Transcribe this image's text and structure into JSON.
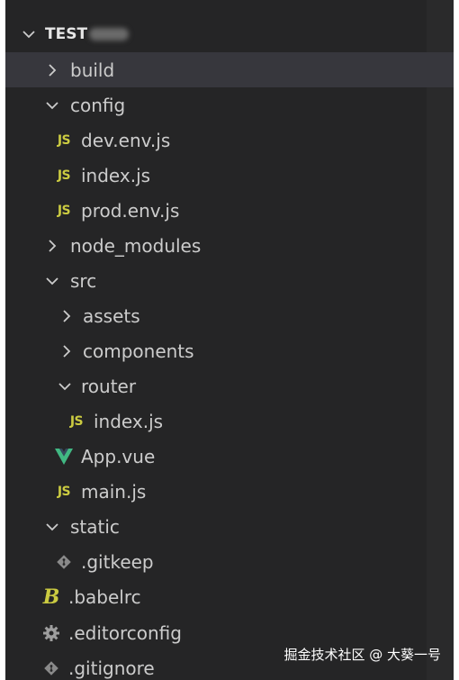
{
  "explorer": {
    "root": {
      "label": "TEST"
    },
    "items": [
      {
        "label": "build",
        "type": "folder",
        "expanded": false,
        "icon": "chevron-right-icon"
      },
      {
        "label": "config",
        "type": "folder",
        "expanded": true,
        "icon": "chevron-down-icon"
      },
      {
        "label": "dev.env.js",
        "type": "file",
        "icon": "js-file-icon",
        "badge": "JS"
      },
      {
        "label": "index.js",
        "type": "file",
        "icon": "js-file-icon",
        "badge": "JS"
      },
      {
        "label": "prod.env.js",
        "type": "file",
        "icon": "js-file-icon",
        "badge": "JS"
      },
      {
        "label": "node_modules",
        "type": "folder",
        "expanded": false,
        "icon": "chevron-right-icon"
      },
      {
        "label": "src",
        "type": "folder",
        "expanded": true,
        "icon": "chevron-down-icon"
      },
      {
        "label": "assets",
        "type": "folder",
        "expanded": false,
        "icon": "chevron-right-icon"
      },
      {
        "label": "components",
        "type": "folder",
        "expanded": false,
        "icon": "chevron-right-icon"
      },
      {
        "label": "router",
        "type": "folder",
        "expanded": true,
        "icon": "chevron-down-icon"
      },
      {
        "label": "index.js",
        "type": "file",
        "icon": "js-file-icon",
        "badge": "JS"
      },
      {
        "label": "App.vue",
        "type": "file",
        "icon": "vue-icon"
      },
      {
        "label": "main.js",
        "type": "file",
        "icon": "js-file-icon",
        "badge": "JS"
      },
      {
        "label": "static",
        "type": "folder",
        "expanded": true,
        "icon": "chevron-down-icon"
      },
      {
        "label": ".gitkeep",
        "type": "file",
        "icon": "git-icon"
      },
      {
        "label": ".babelrc",
        "type": "file",
        "icon": "babel-icon",
        "badge": "B"
      },
      {
        "label": ".editorconfig",
        "type": "file",
        "icon": "gear-icon"
      },
      {
        "label": ".gitignore",
        "type": "file",
        "icon": "git-icon"
      }
    ]
  },
  "watermark": "掘金技术社区 @ 大葵一号",
  "colors": {
    "background": "#252526",
    "selected": "#37373d",
    "js": "#cbcb41",
    "vue_light": "#41b883",
    "vue_dark": "#35495e",
    "git": "#8a8a8a"
  }
}
